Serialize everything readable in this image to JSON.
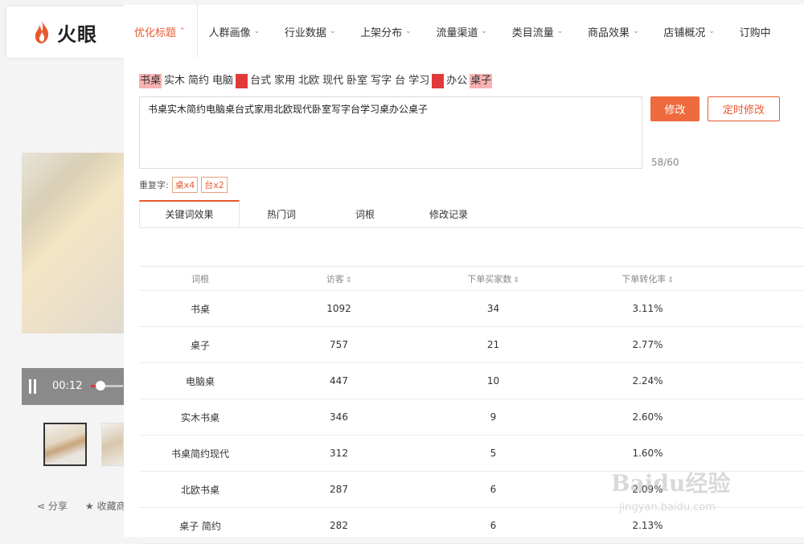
{
  "brand": {
    "logo_text": "火眼"
  },
  "nav": {
    "items": [
      {
        "label": "优化标题",
        "active": true
      },
      {
        "label": "人群画像"
      },
      {
        "label": "行业数据"
      },
      {
        "label": "上架分布"
      },
      {
        "label": "流量渠道"
      },
      {
        "label": "类目流量"
      },
      {
        "label": "商品效果"
      },
      {
        "label": "店铺概况"
      },
      {
        "label": "订购中"
      }
    ]
  },
  "video": {
    "time": "00:12",
    "progress": 0.3
  },
  "product_actions": {
    "share": "分享",
    "favorite": "收藏商品"
  },
  "title_tokens": [
    {
      "text": "书桌",
      "style": "hl"
    },
    {
      "text": "实木"
    },
    {
      "text": "简约"
    },
    {
      "text": "电脑"
    },
    {
      "text": "桌",
      "style": "dup"
    },
    {
      "text": "台式"
    },
    {
      "text": "家用"
    },
    {
      "text": "北欧"
    },
    {
      "text": "现代"
    },
    {
      "text": "卧室"
    },
    {
      "text": "写字"
    },
    {
      "text": "台"
    },
    {
      "text": "学习"
    },
    {
      "text": "桌",
      "style": "dup"
    },
    {
      "text": "办公"
    },
    {
      "text": "桌子",
      "style": "hl"
    }
  ],
  "editor": {
    "title_value": "书桌实木简约电脑桌台式家用北欧现代卧室写字台学习桌办公桌子",
    "modify_label": "修改",
    "schedule_label": "定时修改",
    "char_count": "58/60"
  },
  "duplicates": {
    "label": "重复字:",
    "items": [
      "桌x4",
      "台x2"
    ]
  },
  "tabs": [
    {
      "label": "关键词效果",
      "active": true
    },
    {
      "label": "热门词"
    },
    {
      "label": "词根"
    },
    {
      "label": "修改记录"
    }
  ],
  "table": {
    "headers": [
      "词根",
      "访客",
      "下单买家数",
      "下单转化率"
    ],
    "rows": [
      [
        "书桌",
        "1092",
        "34",
        "3.11%"
      ],
      [
        "桌子",
        "757",
        "21",
        "2.77%"
      ],
      [
        "电脑桌",
        "447",
        "10",
        "2.24%"
      ],
      [
        "实木书桌",
        "346",
        "9",
        "2.60%"
      ],
      [
        "书桌简约现代",
        "312",
        "5",
        "1.60%"
      ],
      [
        "北欧书桌",
        "287",
        "6",
        "2.09%"
      ],
      [
        "桌子 简约",
        "282",
        "6",
        "2.13%"
      ]
    ]
  },
  "watermark": {
    "text": "Baidu经验",
    "sub": "jingyan.baidu.com"
  },
  "colors": {
    "accent": "#e8592f",
    "button": "#ef6a3c",
    "highlight": "#f8b2b2",
    "duplicate": "#e03a3a"
  }
}
